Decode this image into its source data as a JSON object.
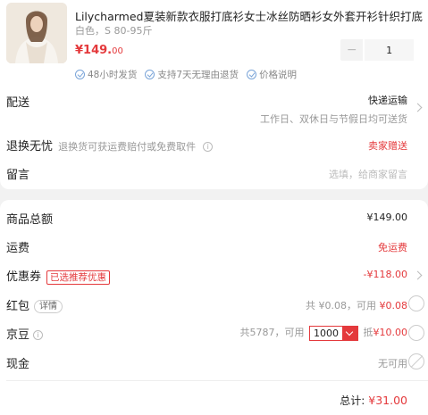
{
  "product": {
    "title": "Lilycharmed夏装新款衣服打底衫女士冰丝防晒衫女外套开衫针织打底",
    "spec": "白色，S 80-95斤",
    "price_symbol": "¥",
    "price_int": "149.",
    "price_dec": "00",
    "qty_minus": "−",
    "quantity": "1",
    "services": [
      "48小时发货",
      "支持7天无理由退货",
      "价格说明"
    ]
  },
  "delivery": {
    "label": "配送",
    "method": "快递运输",
    "time": "工作日、双休日与节假日均可送货"
  },
  "returns": {
    "label": "退换无忧",
    "desc": "退换货可获运费赔付或免费取件",
    "badge": "卖家赠送"
  },
  "message": {
    "label": "留言",
    "placeholder": "选填，给商家留言"
  },
  "summary": {
    "goods_label": "商品总额",
    "goods_value": "¥149.00",
    "freight_label": "运费",
    "freight_value": "免运费",
    "coupon_label": "优惠券",
    "coupon_tag": "已选推荐优惠",
    "coupon_value": "-¥118.00",
    "redpacket_label": "红包",
    "redpacket_detail": "详情",
    "redpacket_info": "共 ¥0.08，可用",
    "redpacket_value": "¥0.08",
    "bean_label": "京豆",
    "bean_info_prefix": "共5787，可用",
    "bean_selected": "1000",
    "bean_deduct_prefix": "抵",
    "bean_deduct_value": "¥10.00",
    "cash_label": "现金",
    "cash_value": "无可用",
    "total_label": "总计:",
    "total_value": "¥31.00"
  },
  "colors": {
    "accent": "#e4393c",
    "service_icon": "#7aa4d8"
  }
}
